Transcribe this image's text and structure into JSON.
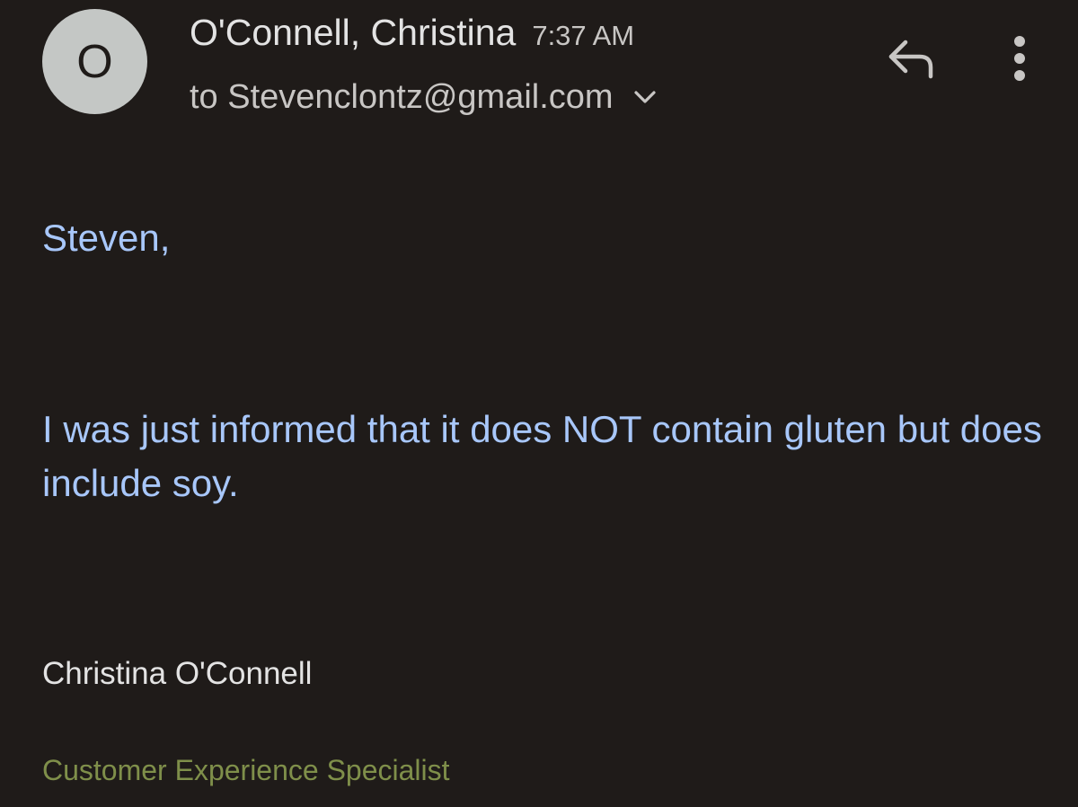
{
  "header": {
    "avatar_letter": "O",
    "sender_name": "O'Connell, Christina",
    "timestamp": "7:37 AM",
    "recipient": "to Stevenclontz@gmail.com"
  },
  "icons": {
    "expand": "chevron-down-icon",
    "reply": "reply-icon",
    "more": "more-vert-icon"
  },
  "body": {
    "greeting": "Steven,",
    "message": "I was just informed that it does NOT contain gluten but does include soy."
  },
  "signature": {
    "name": "Christina O'Connell",
    "title": "Customer Experience Specialist"
  },
  "colors": {
    "background": "#1f1b19",
    "body_text": "#a8c7fa",
    "signature_title": "#7f8f4a"
  }
}
